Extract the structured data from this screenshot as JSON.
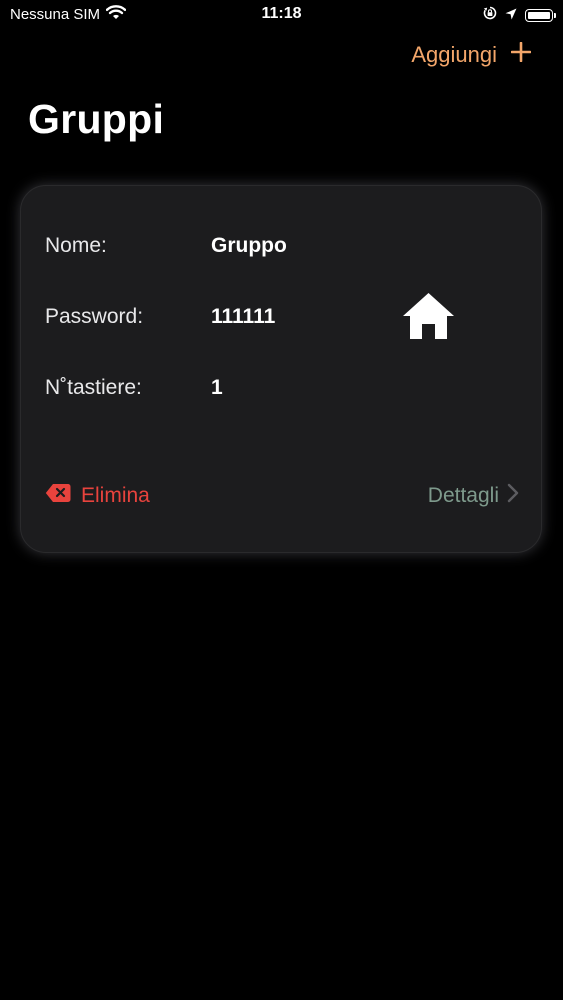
{
  "status_bar": {
    "carrier": "Nessuna SIM",
    "time": "11:18"
  },
  "nav": {
    "add_label": "Aggiungi",
    "add_symbol": "+",
    "title": "Gruppi"
  },
  "group": {
    "name_label": "Nome:",
    "name_value": "Gruppo",
    "password_label": "Password:",
    "password_value": "111111",
    "keyboards_label": "N˚tastiere:",
    "keyboards_value": "1",
    "delete_label": "Elimina",
    "details_label": "Dettagli"
  },
  "colors": {
    "background": "#000000",
    "card": "#1c1c1e",
    "accent": "#f3a66a",
    "delete": "#e8433d",
    "details": "#7e9a8c"
  },
  "icons": [
    "wifi-icon",
    "orientation-lock-icon",
    "location-icon",
    "battery-icon",
    "plus-icon",
    "home-icon",
    "delete-icon",
    "chevron-right-icon"
  ]
}
